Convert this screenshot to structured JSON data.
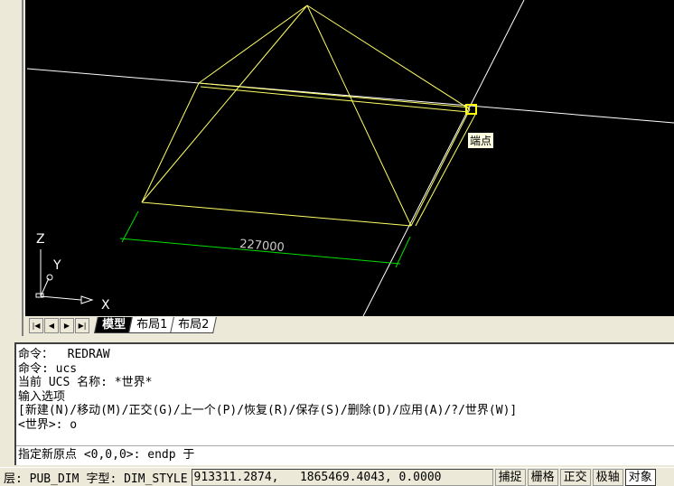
{
  "drawing": {
    "dimension_text": "227000",
    "osnap_tooltip": "端点",
    "ucs_labels": {
      "x": "X",
      "y": "Y",
      "z": "Z"
    }
  },
  "tabs": [
    {
      "label": "模型",
      "active": true
    },
    {
      "label": "布局1"
    },
    {
      "label": "布局2"
    }
  ],
  "command": {
    "history": [
      "命令：  REDRAW",
      "命令: ucs",
      "当前 UCS 名称: *世界*",
      "输入选项",
      "[新建(N)/移动(M)/正交(G)/上一个(P)/恢复(R)/保存(S)/删除(D)/应用(A)/?/世界(W)]",
      "<世界>: o"
    ],
    "input": "指定新原点 <0,0,0>: endp 于"
  },
  "status": {
    "layer": "层: PUB_DIM",
    "textstyle": "字型: DIM_STYLE",
    "coords": "913311.2874,   1865469.4043, 0.0000",
    "buttons": [
      "捕捉",
      "栅格",
      "正交",
      "极轴",
      "对象"
    ]
  },
  "colors": {
    "yellow": "#ffff66",
    "green": "#00e000",
    "white": "#ffffff"
  }
}
